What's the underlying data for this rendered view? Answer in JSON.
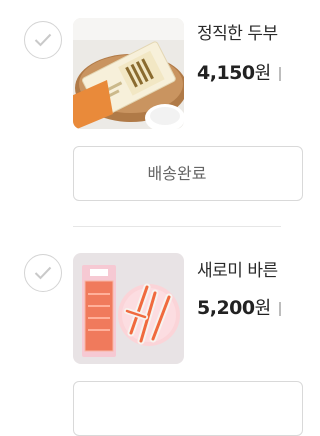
{
  "orders": [
    {
      "product_name": "정직한 두부",
      "price": "4,150",
      "currency": "원",
      "status_button": "배송완료",
      "thumbnail": "tofu-package-photo"
    },
    {
      "product_name": "새로미 바른",
      "price": "5,200",
      "currency": "원",
      "status_button": "",
      "thumbnail": "crab-stick-package-photo"
    }
  ],
  "colors": {
    "text": "#222222",
    "border": "#d9d9d9",
    "muted": "#666666"
  }
}
